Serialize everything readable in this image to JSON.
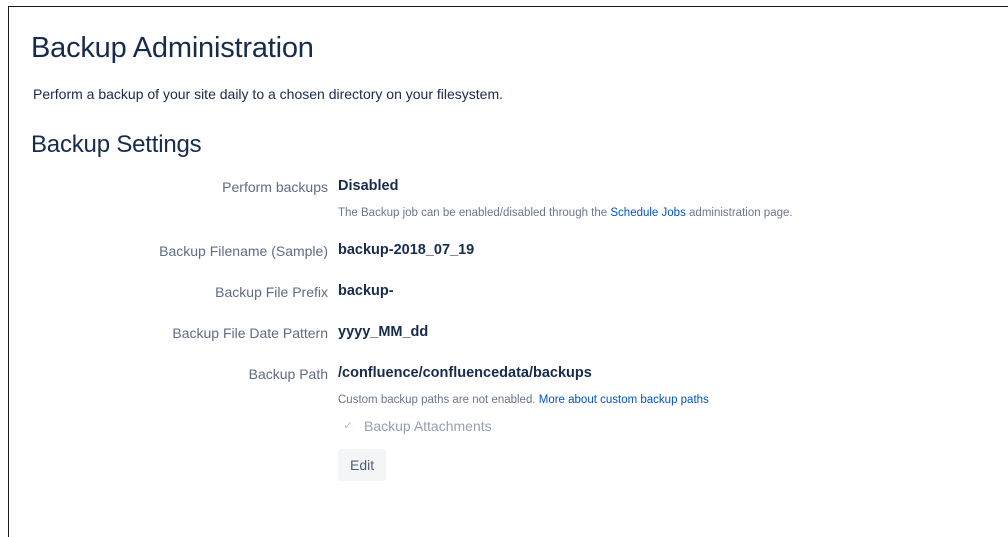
{
  "page": {
    "title": "Backup Administration",
    "intro": "Perform a backup of your site daily to a chosen directory on your filesystem."
  },
  "settings": {
    "heading": "Backup Settings",
    "perform_backups": {
      "label": "Perform backups",
      "value": "Disabled",
      "desc_prefix": "The Backup job can be enabled/disabled through the ",
      "desc_link": "Schedule Jobs",
      "desc_suffix": " administration page."
    },
    "filename": {
      "label": "Backup Filename (Sample)",
      "value": "backup-2018_07_19"
    },
    "prefix": {
      "label": "Backup File Prefix",
      "value": "backup-"
    },
    "date_pattern": {
      "label": "Backup File Date Pattern",
      "value": "yyyy_MM_dd"
    },
    "path": {
      "label": "Backup Path",
      "value": "/confluence/confluencedata/backups",
      "desc_prefix": "Custom backup paths are not enabled. ",
      "desc_link": "More about custom backup paths"
    },
    "attachments": {
      "label": "Backup Attachments",
      "checked": true,
      "disabled": true
    },
    "edit_label": "Edit"
  },
  "colors": {
    "text": "#172b4d",
    "label": "#5e6c84",
    "link": "#0052cc",
    "button_bg": "#f4f5f7"
  },
  "icons": {
    "checkbox": "checkmark-icon"
  }
}
